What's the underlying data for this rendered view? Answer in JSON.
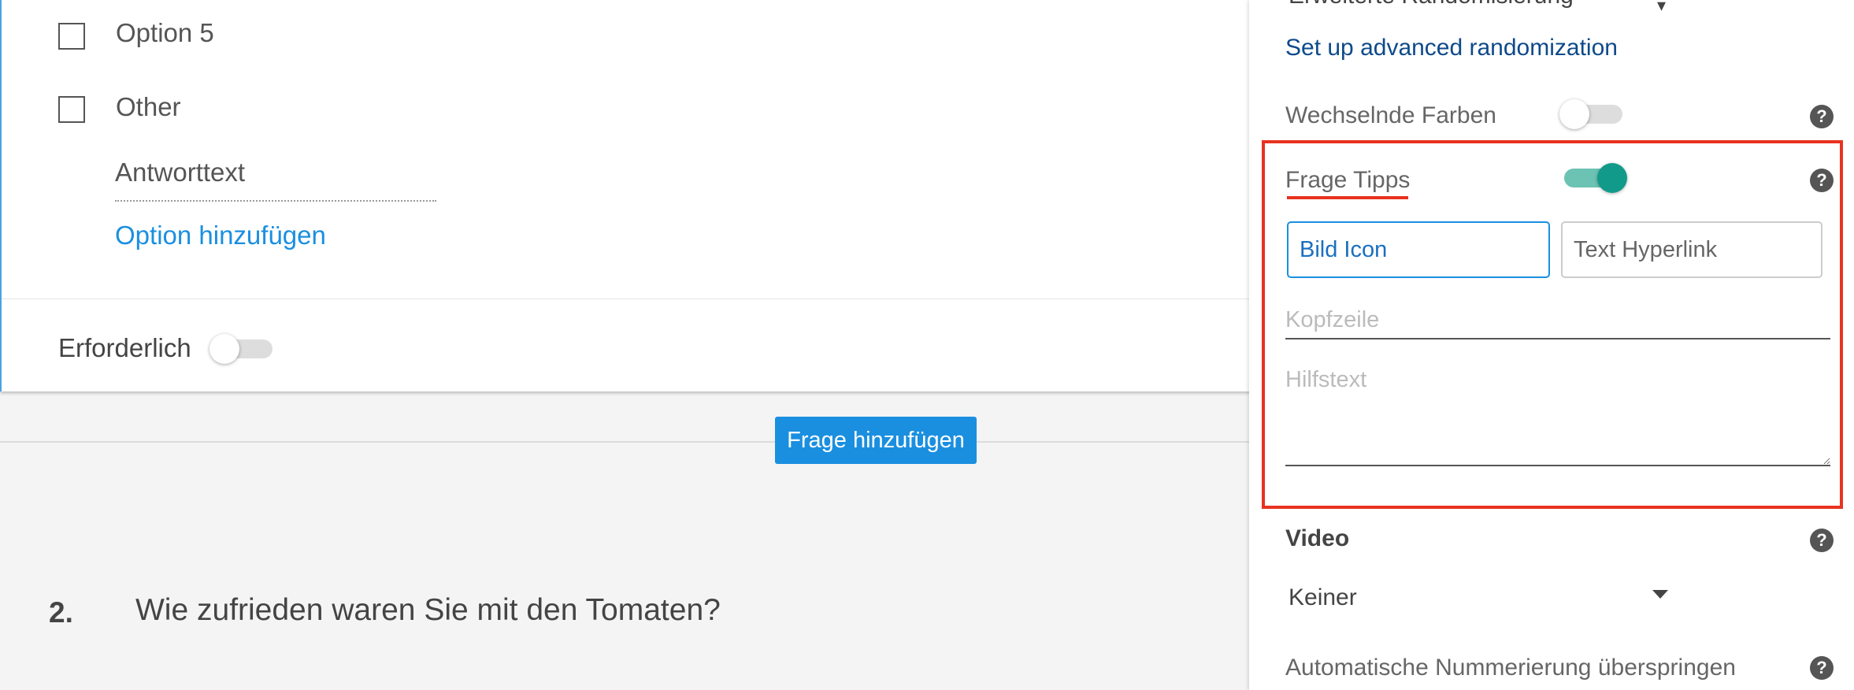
{
  "question_card": {
    "options": [
      {
        "label": "Option 5"
      },
      {
        "label": "Other"
      }
    ],
    "answer_text_placeholder": "Antworttext",
    "add_option_label": "Option hinzufügen",
    "required_label": "Erforderlich",
    "required_enabled": false
  },
  "add_question_button": "Frage hinzufügen",
  "next_question": {
    "number": "2.",
    "text": "Wie zufrieden waren Sie mit den Tomaten?"
  },
  "settings_panel": {
    "randomization_select_cut": "Erweiterte Randomisierung",
    "advanced_randomization_link": "Set up advanced randomization",
    "alternating_colors": {
      "label": "Wechselnde Farben",
      "enabled": false
    },
    "question_tips": {
      "label": "Frage Tipps",
      "enabled": true,
      "tabs": [
        {
          "label": "Bild Icon",
          "active": true
        },
        {
          "label": "Text Hyperlink",
          "active": false
        }
      ],
      "header_placeholder": "Kopfzeile",
      "help_text_placeholder": "Hilfstext"
    },
    "video": {
      "label": "Video",
      "selected": "Keiner"
    },
    "skip_numbering": {
      "label": "Automatische Nummerierung überspringen"
    },
    "help_icon_glyph": "?"
  },
  "colors": {
    "accent_blue": "#1a8fe0",
    "link_dark_blue": "#0e4a8a",
    "toggle_on": "#119a8a",
    "highlight_red": "#e8321f"
  }
}
